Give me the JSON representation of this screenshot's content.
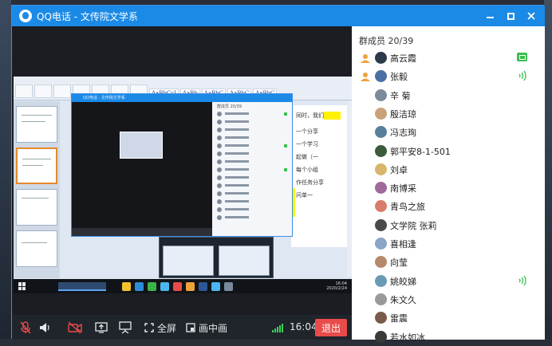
{
  "window": {
    "title": "QQ电话 - 文传院文学系",
    "accent": "#1a8ae6"
  },
  "shared_screen": {
    "word_title": "",
    "doc_lines": [
      "同时，我们",
      "一个分享",
      "一个学习",
      "起做（一",
      "每个小组",
      "作任务分享",
      "问单一"
    ],
    "inner_window_title": "QQ电话 - 文传院文学系",
    "inner_members_header": "群成员 20/39",
    "taskbar_clock": [
      "16:04",
      "2020/2/24"
    ],
    "style_chips": [
      "AaBbCcI",
      "AaBb",
      "AaBbC",
      "AaBbC",
      "AaBbC"
    ]
  },
  "toolbar": {
    "fullscreen_label": "全屏",
    "pip_label": "画中画",
    "time": "16:04",
    "exit_label": "退出"
  },
  "members_panel": {
    "header": "群成员 20/39",
    "members": [
      {
        "name": "高云霞",
        "role": "admin",
        "sharing": true,
        "speaking": false
      },
      {
        "name": "张毅",
        "role": "admin",
        "sharing": false,
        "speaking": true
      },
      {
        "name": "辛 菊",
        "role": "",
        "sharing": false,
        "speaking": false
      },
      {
        "name": "殷洁琼",
        "role": "",
        "sharing": false,
        "speaking": false
      },
      {
        "name": "冯志珣",
        "role": "",
        "sharing": false,
        "speaking": false
      },
      {
        "name": "郭平安8-1-501",
        "role": "",
        "sharing": false,
        "speaking": false
      },
      {
        "name": "刘卓",
        "role": "",
        "sharing": false,
        "speaking": false
      },
      {
        "name": "南博采",
        "role": "",
        "sharing": false,
        "speaking": false
      },
      {
        "name": "青鸟之旅",
        "role": "",
        "sharing": false,
        "speaking": false
      },
      {
        "name": "文学院 张莉",
        "role": "",
        "sharing": false,
        "speaking": false
      },
      {
        "name": "喜相逢",
        "role": "",
        "sharing": false,
        "speaking": false
      },
      {
        "name": "向莹",
        "role": "",
        "sharing": false,
        "speaking": false
      },
      {
        "name": "姚皎娣",
        "role": "",
        "sharing": false,
        "speaking": true
      },
      {
        "name": "朱文久",
        "role": "",
        "sharing": false,
        "speaking": false
      },
      {
        "name": "雷震",
        "role": "",
        "sharing": false,
        "speaking": false
      },
      {
        "name": "若水如冰",
        "role": "",
        "sharing": false,
        "speaking": false
      }
    ]
  },
  "colors": {
    "speaking": "#3bbd4e",
    "exit": "#e94b4b",
    "admin_icon": "#f0a13a"
  }
}
